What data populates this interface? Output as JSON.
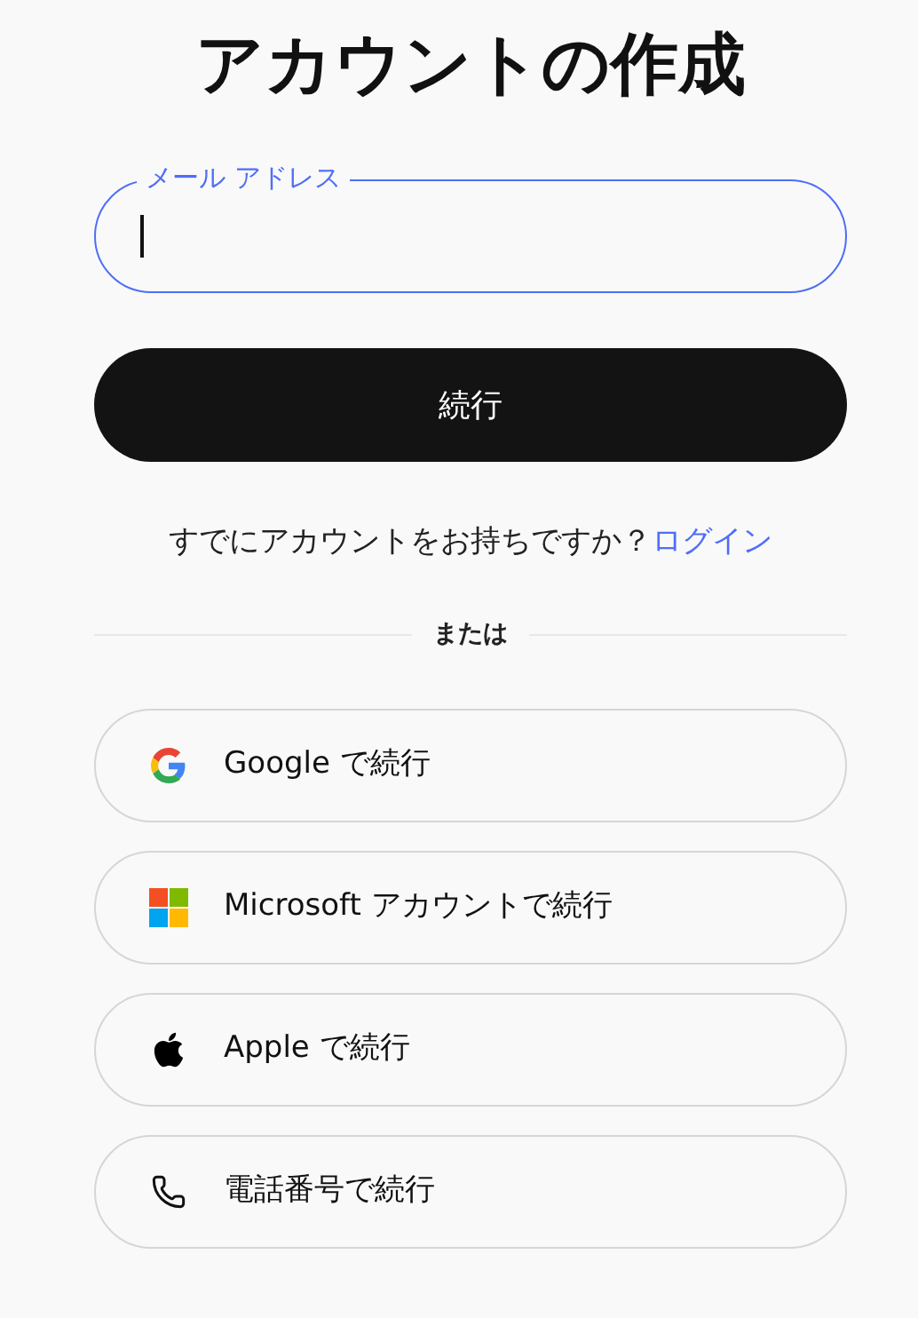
{
  "title": "アカウントの作成",
  "email_field": {
    "label": "メール アドレス",
    "focused": true
  },
  "continue_button": "続行",
  "login_prompt": {
    "text": "すでにアカウントをお持ちですか？",
    "link": "ログイン"
  },
  "divider": "または",
  "providers": [
    {
      "kind": "google",
      "label": "Google で続行"
    },
    {
      "kind": "microsoft",
      "label": "Microsoft アカウントで続行"
    },
    {
      "kind": "apple",
      "label": "Apple で続行"
    },
    {
      "kind": "phone",
      "label": "電話番号で続行"
    }
  ]
}
